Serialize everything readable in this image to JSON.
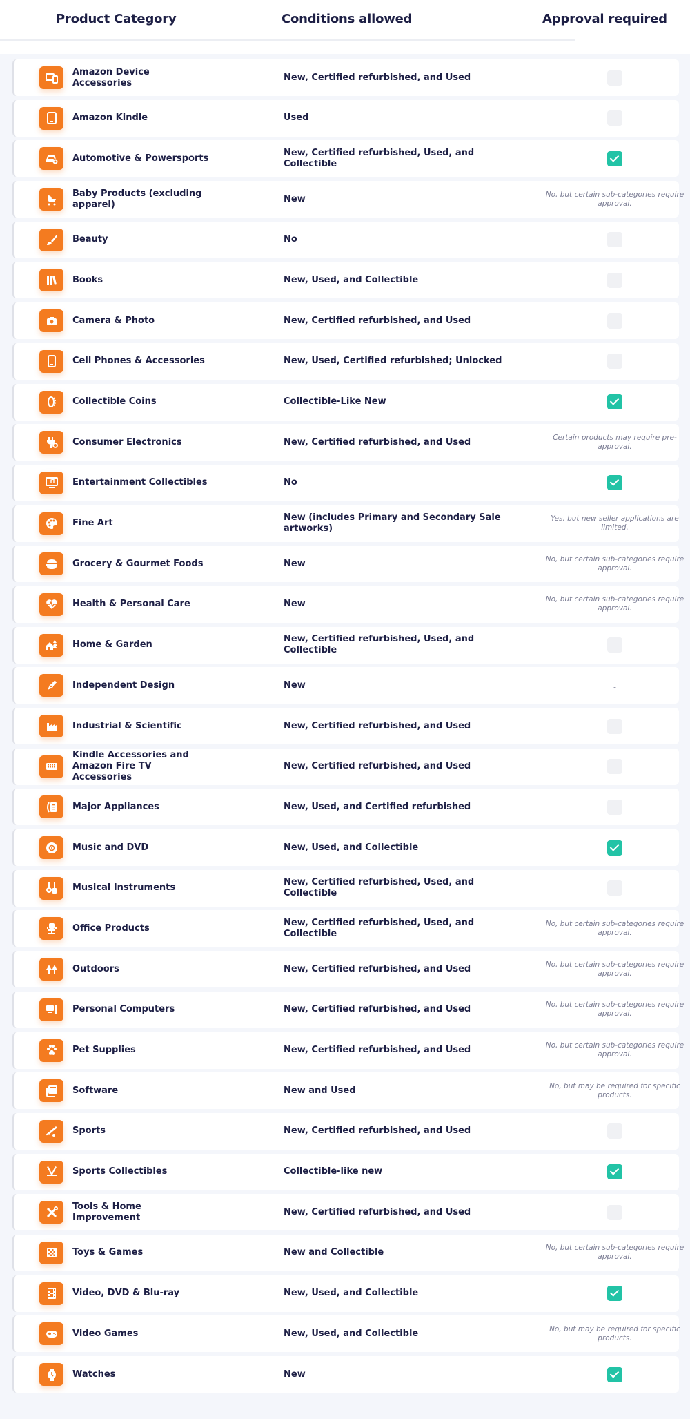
{
  "header": {
    "col_category": "Product Category",
    "col_conditions": "Conditions allowed",
    "col_approval": "Approval required"
  },
  "colors": {
    "accent_orange": "#f47b20",
    "check_teal": "#22c3a6",
    "text_dark": "#1d1f45",
    "note_gray": "#7b7d94",
    "panel_bg": "#f4f6fb"
  },
  "rows": [
    {
      "icon": "devices-icon",
      "category": "Amazon Device Accessories",
      "conditions": "New, Certified refurbished, and Used",
      "approval": {
        "type": "checkbox",
        "checked": false
      }
    },
    {
      "icon": "tablet-icon",
      "category": "Amazon Kindle",
      "conditions": "Used",
      "approval": {
        "type": "checkbox",
        "checked": false
      }
    },
    {
      "icon": "car-icon",
      "category": "Automotive & Powersports",
      "conditions": "New, Certified refurbished, Used, and Collectible",
      "approval": {
        "type": "checkbox",
        "checked": true
      }
    },
    {
      "icon": "stroller-icon",
      "category": "Baby Products (excluding apparel)",
      "conditions": "New",
      "approval": {
        "type": "note",
        "text": "No, but certain sub-categories require approval."
      }
    },
    {
      "icon": "brush-icon",
      "category": "Beauty",
      "conditions": "No",
      "approval": {
        "type": "checkbox",
        "checked": false
      }
    },
    {
      "icon": "books-icon",
      "category": "Books",
      "conditions": "New, Used, and Collectible",
      "approval": {
        "type": "checkbox",
        "checked": false
      }
    },
    {
      "icon": "camera-icon",
      "category": "Camera & Photo",
      "conditions": "New, Certified refurbished, and Used",
      "approval": {
        "type": "checkbox",
        "checked": false
      }
    },
    {
      "icon": "phone-icon",
      "category": "Cell Phones & Accessories",
      "conditions": "New, Used, Certified refurbished; Unlocked",
      "approval": {
        "type": "checkbox",
        "checked": false
      }
    },
    {
      "icon": "coin-icon",
      "category": "Collectible Coins",
      "conditions": "Collectible-Like New",
      "approval": {
        "type": "checkbox",
        "checked": true
      }
    },
    {
      "icon": "plug-icon",
      "category": "Consumer Electronics",
      "conditions": "New, Certified refurbished, and Used",
      "approval": {
        "type": "note",
        "text": "Certain products may require pre-approval."
      }
    },
    {
      "icon": "monitor-music-icon",
      "category": "Entertainment Collectibles",
      "conditions": "No",
      "approval": {
        "type": "checkbox",
        "checked": true
      }
    },
    {
      "icon": "palette-icon",
      "category": "Fine Art",
      "conditions": "New (includes Primary and Secondary Sale artworks)",
      "approval": {
        "type": "note",
        "text": "Yes, but new seller applications are limited."
      }
    },
    {
      "icon": "food-icon",
      "category": "Grocery & Gourmet Foods",
      "conditions": "New",
      "approval": {
        "type": "note",
        "text": "No, but certain sub-categories require approval."
      }
    },
    {
      "icon": "heart-pulse-icon",
      "category": "Health & Personal Care",
      "conditions": "New",
      "approval": {
        "type": "note",
        "text": "No, but certain sub-categories require approval."
      }
    },
    {
      "icon": "home-tree-icon",
      "category": "Home & Garden",
      "conditions": "New, Certified refurbished, Used, and Collectible",
      "approval": {
        "type": "checkbox",
        "checked": false
      }
    },
    {
      "icon": "pen-nib-icon",
      "category": "Independent Design",
      "conditions": "New",
      "approval": {
        "type": "dash",
        "text": "-"
      }
    },
    {
      "icon": "factory-icon",
      "category": "Industrial & Scientific",
      "conditions": "New, Certified refurbished, and Used",
      "approval": {
        "type": "checkbox",
        "checked": false
      }
    },
    {
      "icon": "keyboard-icon",
      "category": "Kindle Accessories and Amazon Fire TV Accessories",
      "conditions": "New, Certified refurbished, and Used",
      "approval": {
        "type": "checkbox",
        "checked": false
      }
    },
    {
      "icon": "appliance-icon",
      "category": "Major Appliances",
      "conditions": "New, Used, and Certified refurbished",
      "approval": {
        "type": "checkbox",
        "checked": false
      }
    },
    {
      "icon": "disc-icon",
      "category": "Music and DVD",
      "conditions": "New, Used, and Collectible",
      "approval": {
        "type": "checkbox",
        "checked": true
      }
    },
    {
      "icon": "guitar-icon",
      "category": "Musical Instruments",
      "conditions": "New, Certified refurbished, Used, and Collectible",
      "approval": {
        "type": "checkbox",
        "checked": false
      }
    },
    {
      "icon": "office-chair-icon",
      "category": "Office Products",
      "conditions": "New, Certified refurbished, Used, and Collectible",
      "approval": {
        "type": "note",
        "text": "No, but certain sub-categories require approval."
      }
    },
    {
      "icon": "trees-icon",
      "category": "Outdoors",
      "conditions": "New, Certified refurbished, and Used",
      "approval": {
        "type": "note",
        "text": "No, but certain sub-categories require approval."
      }
    },
    {
      "icon": "computer-icon",
      "category": "Personal Computers",
      "conditions": "New, Certified refurbished, and Used",
      "approval": {
        "type": "note",
        "text": "No, but certain sub-categories require approval."
      }
    },
    {
      "icon": "paw-icon",
      "category": "Pet Supplies",
      "conditions": "New, Certified refurbished, and Used",
      "approval": {
        "type": "note",
        "text": "No, but certain sub-categories require approval."
      }
    },
    {
      "icon": "window-icon",
      "category": "Software",
      "conditions": "New and Used",
      "approval": {
        "type": "note",
        "text": "No, but may be required for specific products."
      }
    },
    {
      "icon": "bat-ball-icon",
      "category": "Sports",
      "conditions": "New, Certified refurbished, and Used",
      "approval": {
        "type": "checkbox",
        "checked": false
      }
    },
    {
      "icon": "hockey-sticks-icon",
      "category": "Sports Collectibles",
      "conditions": "Collectible-like new",
      "approval": {
        "type": "checkbox",
        "checked": true
      }
    },
    {
      "icon": "tools-icon",
      "category": "Tools & Home Improvement",
      "conditions": "New, Certified refurbished, and Used",
      "approval": {
        "type": "checkbox",
        "checked": false
      }
    },
    {
      "icon": "checkerboard-icon",
      "category": "Toys & Games",
      "conditions": "New and Collectible",
      "approval": {
        "type": "note",
        "text": "No, but certain sub-categories require approval."
      }
    },
    {
      "icon": "film-icon",
      "category": "Video, DVD & Blu-ray",
      "conditions": "New, Used, and Collectible",
      "approval": {
        "type": "checkbox",
        "checked": true
      }
    },
    {
      "icon": "gamepad-icon",
      "category": "Video Games",
      "conditions": "New, Used, and Collectible",
      "approval": {
        "type": "note",
        "text": "No, but may be required for specific products."
      }
    },
    {
      "icon": "watch-icon",
      "category": "Watches",
      "conditions": "New",
      "approval": {
        "type": "checkbox",
        "checked": true
      }
    }
  ]
}
